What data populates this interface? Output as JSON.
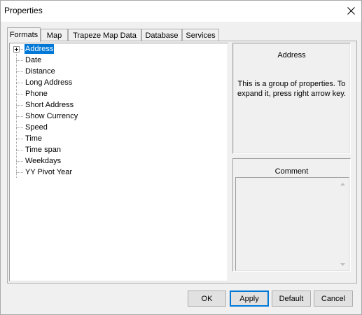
{
  "window": {
    "title": "Properties",
    "close_icon": "close-icon"
  },
  "tabs": [
    {
      "label": "Formats",
      "active": true
    },
    {
      "label": "Map",
      "active": false
    },
    {
      "label": "Trapeze Map Data",
      "active": false
    },
    {
      "label": "Database",
      "active": false
    },
    {
      "label": "Services",
      "active": false
    }
  ],
  "tree": {
    "items": [
      {
        "label": "Address",
        "expandable": true,
        "selected": true
      },
      {
        "label": "Date"
      },
      {
        "label": "Distance"
      },
      {
        "label": "Long Address"
      },
      {
        "label": "Phone"
      },
      {
        "label": "Short Address"
      },
      {
        "label": "Show Currency"
      },
      {
        "label": "Speed"
      },
      {
        "label": "Time"
      },
      {
        "label": "Time span"
      },
      {
        "label": "Weekdays"
      },
      {
        "label": "YY Pivot Year"
      }
    ]
  },
  "description": {
    "title": "Address",
    "text": "This is a group of properties. To expand it, press right arrow key."
  },
  "comment": {
    "label": "Comment",
    "value": ""
  },
  "buttons": {
    "ok": "OK",
    "apply": "Apply",
    "default": "Default",
    "cancel": "Cancel"
  }
}
